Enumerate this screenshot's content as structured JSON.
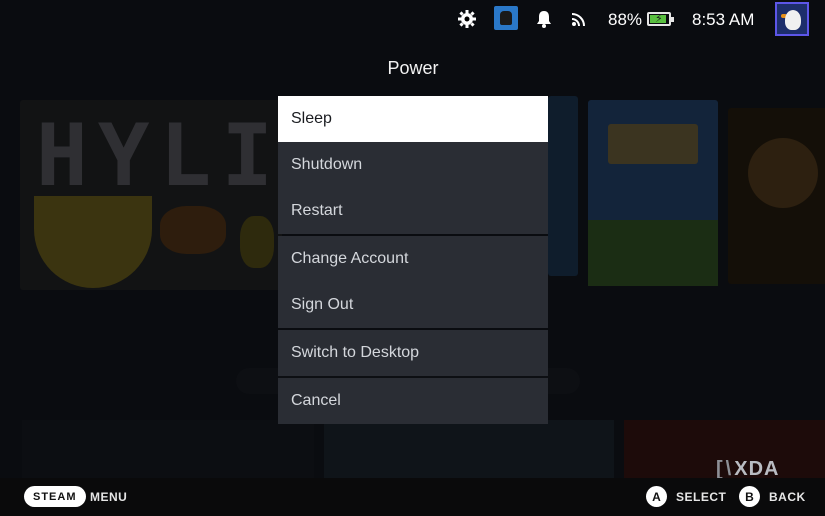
{
  "topbar": {
    "battery_percent": "88%",
    "battery_level": 0.88,
    "time": "8:53 AM"
  },
  "icons": {
    "gear": "gear-icon",
    "app": "app-icon",
    "bell": "bell-icon",
    "cast": "cast-icon",
    "battery": "battery-charging-icon",
    "avatar": "goose-avatar"
  },
  "power_menu": {
    "title": "Power",
    "items": [
      {
        "label": "Sleep",
        "selected": true
      },
      {
        "label": "Shutdown"
      },
      {
        "label": "Restart"
      },
      {
        "label": "Change Account"
      },
      {
        "label": "Sign Out"
      },
      {
        "label": "Switch to Desktop"
      },
      {
        "label": "Cancel"
      }
    ]
  },
  "bottombar": {
    "steam_label": "STEAM",
    "menu_label": "MENU",
    "a_glyph": "A",
    "select_label": "SELECT",
    "b_glyph": "B",
    "back_label": "BACK"
  },
  "watermark": {
    "text": "XDA",
    "bracket": "[",
    "slash": "\\"
  },
  "colors": {
    "menu_item_bg": "#2a2d34",
    "menu_selected_bg": "#ffffff",
    "avatar_border": "#5d56e8",
    "battery_fill": "#59bf40"
  }
}
